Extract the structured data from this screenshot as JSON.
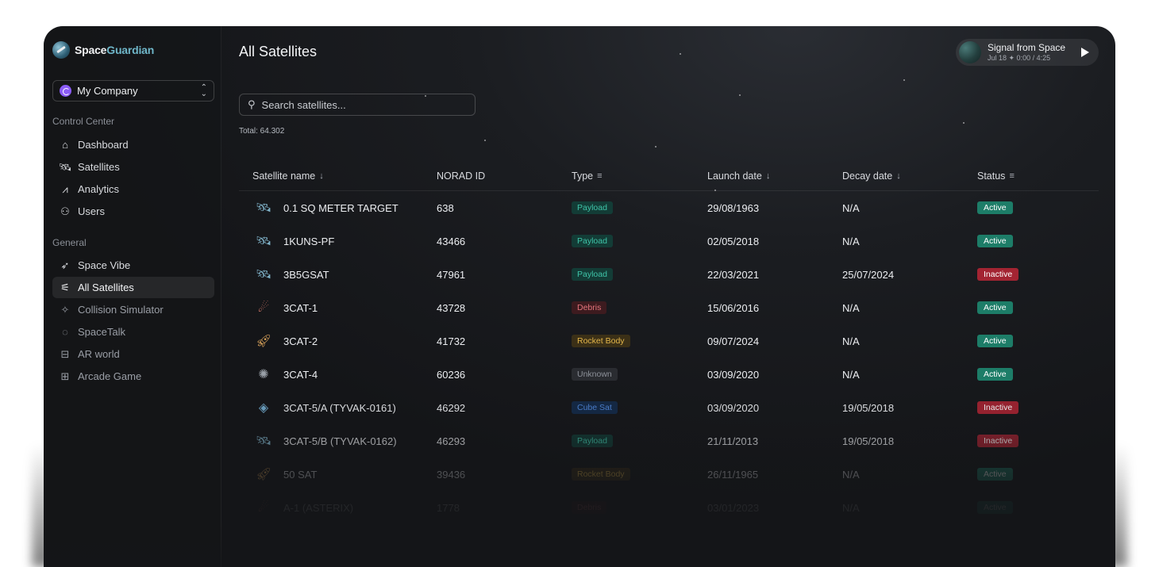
{
  "brand": {
    "name_primary": "Space",
    "name_accent": "Guardian"
  },
  "company": {
    "name": "My Company"
  },
  "sidebar": {
    "section_control": "Control Center",
    "control_items": [
      {
        "label": "Dashboard",
        "icon": "home-icon"
      },
      {
        "label": "Satellites",
        "icon": "satellite-icon"
      },
      {
        "label": "Analytics",
        "icon": "chart-line-icon"
      },
      {
        "label": "Users",
        "icon": "users-icon"
      }
    ],
    "section_general": "General",
    "general_items": [
      {
        "label": "Space Vibe",
        "icon": "rocket-icon"
      },
      {
        "label": "All Satellites",
        "icon": "satellite-dish-icon",
        "active": true
      },
      {
        "label": "Collision Simulator",
        "icon": "sparkle-icon"
      },
      {
        "label": "SpaceTalk",
        "icon": "chat-icon"
      },
      {
        "label": "AR world",
        "icon": "vr-headset-icon"
      },
      {
        "label": "Arcade Game",
        "icon": "gamepad-icon"
      }
    ]
  },
  "main": {
    "title": "All Satellites",
    "search_placeholder": "Search satellites...",
    "total": "Total: 64.302"
  },
  "player": {
    "title": "Signal from Space",
    "meta": "Jul 18 ✦ 0:00 / 4:25"
  },
  "table": {
    "columns": {
      "name": "Satellite name",
      "norad": "NORAD ID",
      "type": "Type",
      "launch": "Launch date",
      "decay": "Decay date",
      "status": "Status"
    },
    "rows": [
      {
        "name": "0.1 SQ METER TARGET",
        "norad": "638",
        "type": "Payload",
        "type_class": "payload",
        "launch": "29/08/1963",
        "decay": "N/A",
        "status": "Active",
        "status_class": "active",
        "icon": "satellite-icon"
      },
      {
        "name": "1KUNS-PF",
        "norad": "43466",
        "type": "Payload",
        "type_class": "payload",
        "launch": "02/05/2018",
        "decay": "N/A",
        "status": "Active",
        "status_class": "active",
        "icon": "satellite-icon"
      },
      {
        "name": "3B5GSAT",
        "norad": "47961",
        "type": "Payload",
        "type_class": "payload",
        "launch": "22/03/2021",
        "decay": "25/07/2024",
        "status": "Inactive",
        "status_class": "inactive",
        "icon": "satellite-icon"
      },
      {
        "name": "3CAT-1",
        "norad": "43728",
        "type": "Debris",
        "type_class": "debris",
        "launch": "15/06/2016",
        "decay": "N/A",
        "status": "Active",
        "status_class": "active",
        "icon": "comet-icon"
      },
      {
        "name": "3CAT-2",
        "norad": "41732",
        "type": "Rocket Body",
        "type_class": "rocket",
        "launch": "09/07/2024",
        "decay": "N/A",
        "status": "Active",
        "status_class": "active",
        "icon": "rocket-icon"
      },
      {
        "name": "3CAT-4",
        "norad": "60236",
        "type": "Unknown",
        "type_class": "unknown",
        "launch": "03/09/2020",
        "decay": "N/A",
        "status": "Active",
        "status_class": "active",
        "icon": "asteroid-icon"
      },
      {
        "name": "3CAT-5/A (TYVAK-0161)",
        "norad": "46292",
        "type": "Cube Sat",
        "type_class": "cube",
        "launch": "03/09/2020",
        "decay": "19/05/2018",
        "status": "Inactive",
        "status_class": "inactive",
        "icon": "cubesat-icon"
      },
      {
        "name": "3CAT-5/B (TYVAK-0162)",
        "norad": "46293",
        "type": "Payload",
        "type_class": "payload",
        "launch": "21/11/2013",
        "decay": "19/05/2018",
        "status": "Inactive",
        "status_class": "inactive",
        "icon": "satellite-icon"
      },
      {
        "name": "50 SAT",
        "norad": "39436",
        "type": "Rocket Body",
        "type_class": "rocket",
        "launch": "26/11/1965",
        "decay": "N/A",
        "status": "Active",
        "status_class": "active",
        "icon": "rocket-icon"
      },
      {
        "name": "A-1 (ASTERIX)",
        "norad": "1778",
        "type": "Debris",
        "type_class": "debris",
        "launch": "03/01/2023",
        "decay": "N/A",
        "status": "Active",
        "status_class": "active",
        "icon": "comet-icon"
      }
    ]
  }
}
